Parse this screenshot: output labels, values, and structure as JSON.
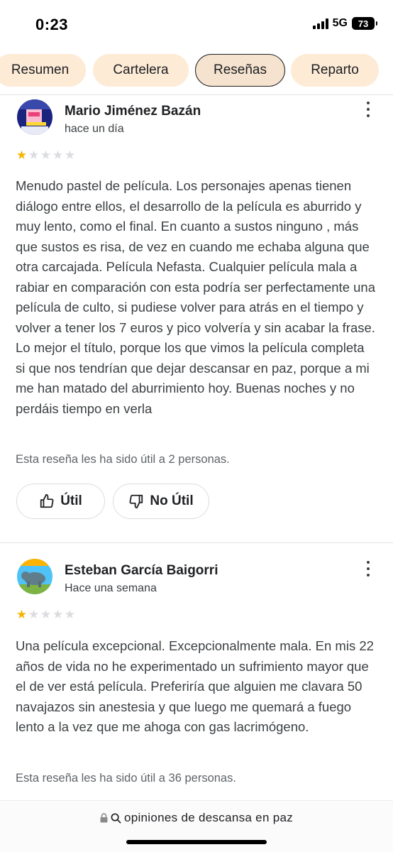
{
  "status_bar": {
    "time": "0:23",
    "network": "5G",
    "battery": "73"
  },
  "tabs": [
    {
      "label": "Resumen",
      "active": false
    },
    {
      "label": "Cartelera",
      "active": false
    },
    {
      "label": "Reseñas",
      "active": true
    },
    {
      "label": "Reparto",
      "active": false
    }
  ],
  "reviews": [
    {
      "author": "Mario Jiménez Bazán",
      "time": "hace un día",
      "rating": 1,
      "max_rating": 5,
      "text": "Menudo pastel de película. Los personajes apenas tienen diálogo entre ellos, el desarrollo de la película es aburrido y muy lento, como el final. En cuanto a sustos ninguno , más que sustos es risa, de vez en cuando me echaba alguna que otra carcajada. Película Nefasta. Cualquier película mala a rabiar en comparación con esta podría ser perfectamente una película de culto, si pudiese volver para atrás en el tiempo y volver a tener los 7 euros y pico volvería y sin acabar la frase. Lo mejor el título, porque los que vimos la película completa si que nos tendrían que dejar descansar en paz, porque a mi me han matado del aburrimiento hoy. Buenas noches y no perdáis tiempo en verla",
      "helpful_text": "Esta reseña les ha sido útil a 2 personas.",
      "useful_label": "Útil",
      "not_useful_label": "No Útil"
    },
    {
      "author": "Esteban García Baigorri",
      "time": "Hace una semana",
      "rating": 1,
      "max_rating": 5,
      "text": "Una película excepcional. Excepcionalmente mala. En mis 22 años de vida no he experimentado un sufrimiento mayor que el de ver está película. Preferiría que alguien me clavara 50 navajazos sin anestesia y que luego me quemará a fuego lento a la vez que me ahoga con gas lacrimógeno.",
      "helpful_text": "Esta reseña les ha sido útil a 36 personas."
    }
  ],
  "bottom_bar": {
    "url_text": "opiniones de descansa en paz",
    "icons": [
      "lock-icon",
      "search-icon"
    ]
  },
  "colors": {
    "star_on": "#f4b400",
    "star_off": "#dadce0",
    "tab_bg": "#fdebd6"
  }
}
